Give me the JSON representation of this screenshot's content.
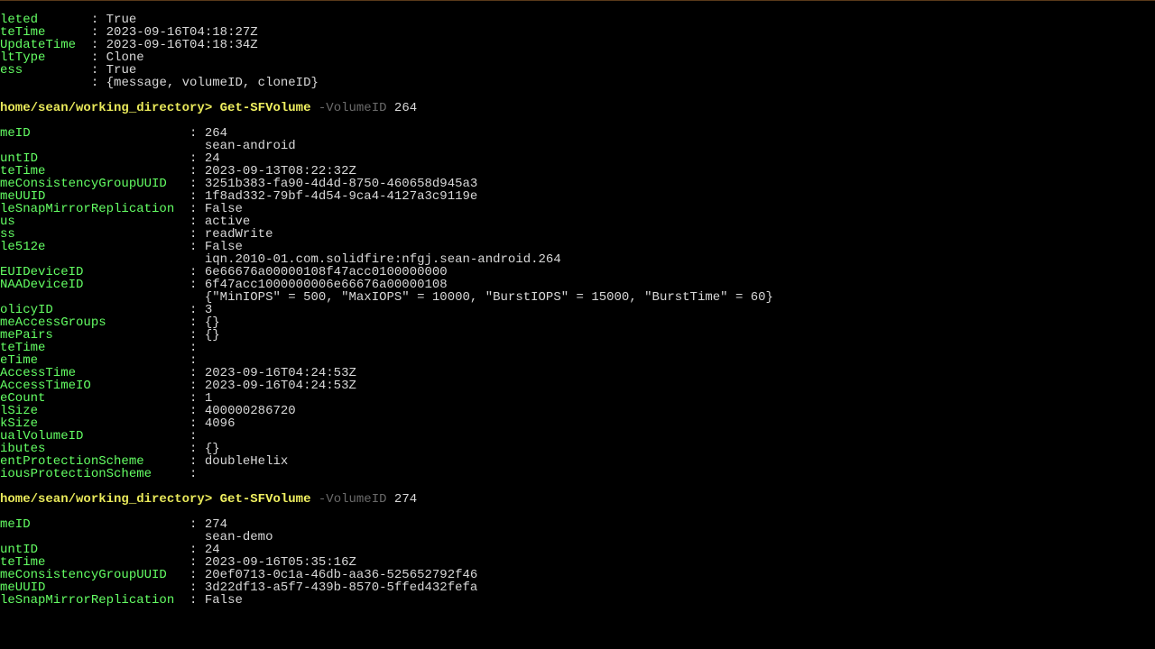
{
  "block1": {
    "rows": [
      {
        "k": "leted",
        "v": "True"
      },
      {
        "k": "teTime",
        "v": "2023-09-16T04:18:27Z"
      },
      {
        "k": "UpdateTime",
        "v": "2023-09-16T04:18:34Z"
      },
      {
        "k": "ltType",
        "v": "Clone"
      },
      {
        "k": "ess",
        "v": "True"
      },
      {
        "k": "",
        "v": "{message, volumeID, cloneID}"
      }
    ]
  },
  "prompt1": {
    "path": "home/sean/working_directory>",
    "cmd": "Get-SFVolume",
    "param": "-VolumeID",
    "arg": "264"
  },
  "block2": {
    "rows": [
      {
        "k": "meID",
        "v": "264"
      },
      {
        "k": "",
        "v": "sean-android"
      },
      {
        "k": "untID",
        "v": "24"
      },
      {
        "k": "teTime",
        "v": "2023-09-13T08:22:32Z"
      },
      {
        "k": "meConsistencyGroupUUID",
        "v": "3251b383-fa90-4d4d-8750-460658d945a3"
      },
      {
        "k": "meUUID",
        "v": "1f8ad332-79bf-4d54-9ca4-4127a3c9119e"
      },
      {
        "k": "leSnapMirrorReplication",
        "v": "False"
      },
      {
        "k": "us",
        "v": "active"
      },
      {
        "k": "ss",
        "v": "readWrite"
      },
      {
        "k": "le512e",
        "v": "False"
      },
      {
        "k": "",
        "v": "iqn.2010-01.com.solidfire:nfgj.sean-android.264"
      },
      {
        "k": "EUIDeviceID",
        "v": "6e66676a00000108f47acc0100000000"
      },
      {
        "k": "NAADeviceID",
        "v": "6f47acc1000000006e66676a00000108"
      },
      {
        "k": "",
        "v": "{\"MinIOPS\" = 500, \"MaxIOPS\" = 10000, \"BurstIOPS\" = 15000, \"BurstTime\" = 60}"
      },
      {
        "k": "olicyID",
        "v": "3"
      },
      {
        "k": "meAccessGroups",
        "v": "{}"
      },
      {
        "k": "mePairs",
        "v": "{}"
      },
      {
        "k": "teTime",
        "v": ""
      },
      {
        "k": "eTime",
        "v": ""
      },
      {
        "k": "AccessTime",
        "v": "2023-09-16T04:24:53Z"
      },
      {
        "k": "AccessTimeIO",
        "v": "2023-09-16T04:24:53Z"
      },
      {
        "k": "eCount",
        "v": "1"
      },
      {
        "k": "lSize",
        "v": "400000286720"
      },
      {
        "k": "kSize",
        "v": "4096"
      },
      {
        "k": "ualVolumeID",
        "v": ""
      },
      {
        "k": "ibutes",
        "v": "{}"
      },
      {
        "k": "entProtectionScheme",
        "v": "doubleHelix"
      },
      {
        "k": "iousProtectionScheme",
        "v": ""
      }
    ]
  },
  "prompt2": {
    "path": "home/sean/working_directory>",
    "cmd": "Get-SFVolume",
    "param": "-VolumeID",
    "arg": "274"
  },
  "block3": {
    "rows": [
      {
        "k": "meID",
        "v": "274"
      },
      {
        "k": "",
        "v": "sean-demo"
      },
      {
        "k": "untID",
        "v": "24"
      },
      {
        "k": "teTime",
        "v": "2023-09-16T05:35:16Z"
      },
      {
        "k": "meConsistencyGroupUUID",
        "v": "20ef0713-0c1a-46db-aa36-525652792f46"
      },
      {
        "k": "meUUID",
        "v": "3d22df13-a5f7-439b-8570-5ffed432fefa"
      },
      {
        "k": "leSnapMirrorReplication",
        "v": "False"
      }
    ]
  },
  "layout": {
    "keyWidthNarrow": 11,
    "keyWidthWide": 24
  }
}
